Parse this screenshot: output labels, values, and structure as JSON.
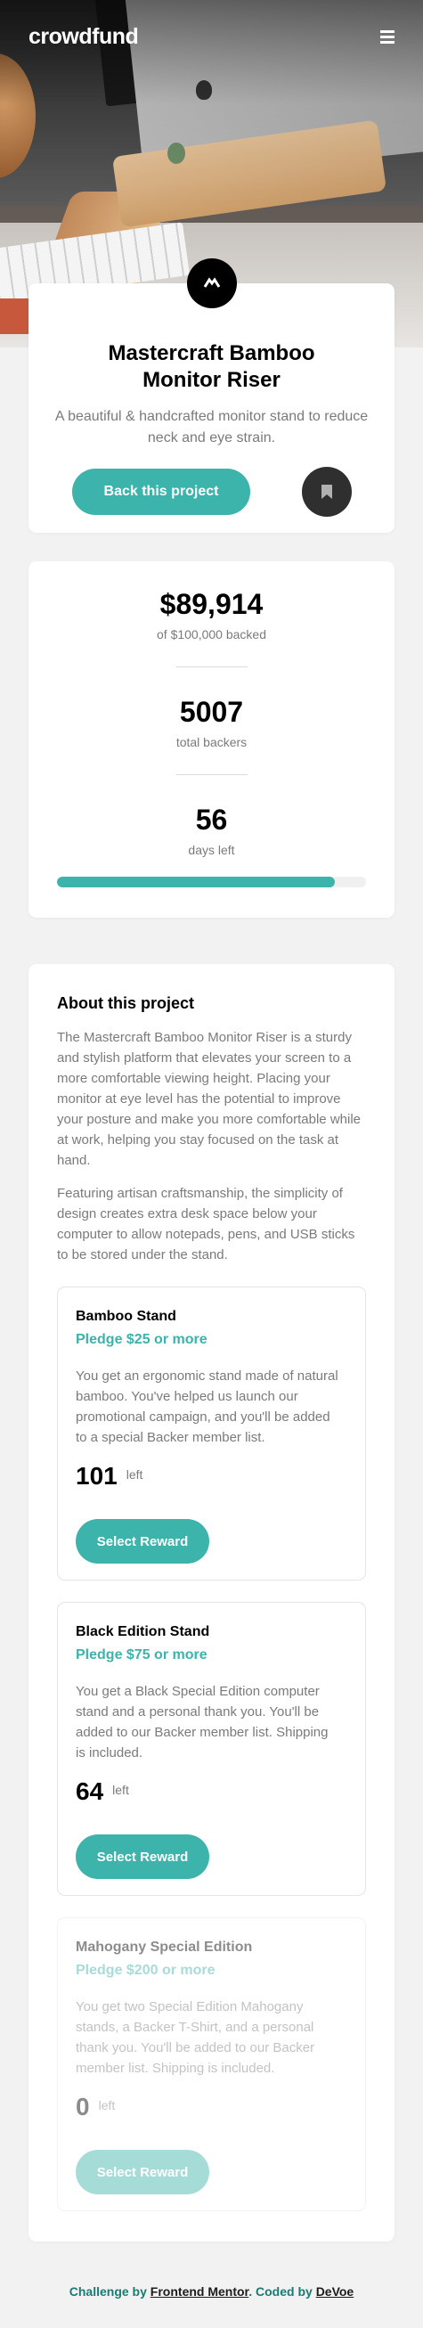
{
  "header": {
    "logo": "crowdfund",
    "menu_icon": "hamburger-icon"
  },
  "intro": {
    "logo_icon": "mastercraft-logo-icon",
    "title": "Mastercraft Bamboo Monitor Riser",
    "description": "A beautiful & handcrafted monitor stand to reduce neck and eye strain.",
    "back_label": "Back this project",
    "bookmark_icon": "bookmark-icon"
  },
  "stats": {
    "backed_amount": "$89,914",
    "backed_label": "of $100,000 backed",
    "backers_count": "5007",
    "backers_label": "total backers",
    "days_left": "56",
    "days_label": "days left",
    "progress_fraction": 0.8991
  },
  "about": {
    "title": "About this project",
    "paragraphs": [
      "The Mastercraft Bamboo Monitor Riser is a sturdy and stylish platform that elevates your screen to a more comfortable viewing height. Placing your monitor at eye level has the potential to improve your posture and make you more comfortable while at work, helping you stay focused on the task at hand.",
      "Featuring artisan craftsmanship, the simplicity of design creates extra desk space below your computer to allow notepads, pens, and USB sticks to be stored under the stand."
    ]
  },
  "rewards": [
    {
      "name": "Bamboo Stand",
      "pledge": "Pledge $25 or more",
      "description": "You get an ergonomic stand made of natural bamboo. You've helped us launch our promotional campaign, and you'll be added to a special Backer member list.",
      "left": "101",
      "left_label": "left",
      "button": "Select Reward"
    },
    {
      "name": "Black Edition Stand",
      "pledge": "Pledge $75 or more",
      "description": "You get a Black Special Edition computer stand and a personal thank you. You'll be added to our Backer member list. Shipping is included.",
      "left": "64",
      "left_label": "left",
      "button": "Select Reward"
    },
    {
      "name": "Mahogany Special Edition",
      "pledge": "Pledge $200 or more",
      "description": "You get two Special Edition Mahogany stands, a Backer T-Shirt, and a personal thank you. You'll be added to our Backer member list. Shipping is included.",
      "left": "0",
      "left_label": "left",
      "button": "Select Reward"
    }
  ],
  "attribution": {
    "prefix": "Challenge by",
    "link1": "Frontend Mentor",
    "middle": ". Coded by",
    "link2": "DeVoe"
  },
  "colors": {
    "accent": "#3cb3ab",
    "accent_dark": "#147a73",
    "text_muted": "#7a7a7a",
    "background": "#f2f2f2"
  }
}
